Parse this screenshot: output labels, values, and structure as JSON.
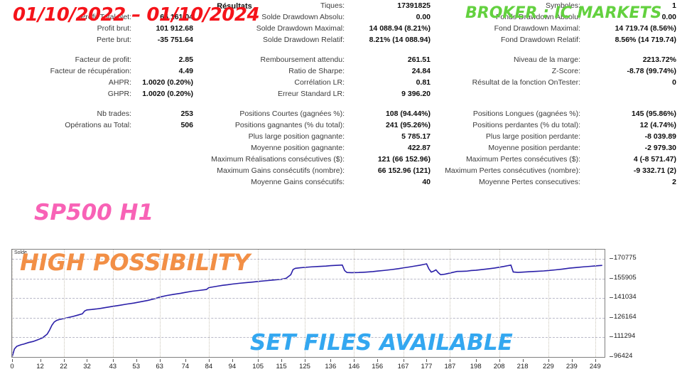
{
  "overlays": {
    "date_range": "01/10/2022  –  01/10/2024",
    "broker": "BROKER : IC MARKETS",
    "symbol_timeframe": "SP500 H1",
    "high_possibility": "HIGH POSSIBILITY",
    "set_files": "SET FILES AVAILABLE",
    "colors": {
      "date_range": "#f5131a",
      "broker": "#63d13f",
      "symbol_timeframe": "#f862b6",
      "high_possibility": "#f28f46",
      "set_files": "#33a7f0"
    }
  },
  "report": {
    "title": "Résultats",
    "groups": [
      {
        "rows": [
          {
            "c1_label": "",
            "c1_value": "",
            "c2_label": "Tiques:",
            "c2_value": "17391825",
            "c3_label": "Symboles:",
            "c3_value": "1"
          },
          {
            "c1_label": "Profit Total Net:",
            "c1_value": "66 161.04",
            "c2_label": "Solde Drawdown Absolu:",
            "c2_value": "0.00",
            "c3_label": "Fonds Drawdown Absolu:",
            "c3_value": "0.00"
          },
          {
            "c1_label": "Profit brut:",
            "c1_value": "101 912.68",
            "c2_label": "Solde Drawdown Maximal:",
            "c2_value": "14 088.94 (8.21%)",
            "c3_label": "Fond Drawdown Maximal:",
            "c3_value": "14 719.74 (8.56%)"
          },
          {
            "c1_label": "Perte brut:",
            "c1_value": "-35 751.64",
            "c2_label": "Solde Drawdown Relatif:",
            "c2_value": "8.21% (14 088.94)",
            "c3_label": "Fond Drawdown Relatif:",
            "c3_value": "8.56% (14 719.74)"
          }
        ]
      },
      {
        "rows": [
          {
            "c1_label": "Facteur de profit:",
            "c1_value": "2.85",
            "c2_label": "Remboursement attendu:",
            "c2_value": "261.51",
            "c3_label": "Niveau de la marge:",
            "c3_value": "2213.72%"
          },
          {
            "c1_label": "Facteur de récupération:",
            "c1_value": "4.49",
            "c2_label": "Ratio de Sharpe:",
            "c2_value": "24.84",
            "c3_label": "Z-Score:",
            "c3_value": "-8.78 (99.74%)"
          },
          {
            "c1_label": "AHPR:",
            "c1_value": "1.0020 (0.20%)",
            "c2_label": "Corrélation LR:",
            "c2_value": "0.81",
            "c3_label": "Résultat de la fonction OnTester:",
            "c3_value": "0"
          },
          {
            "c1_label": "GHPR:",
            "c1_value": "1.0020 (0.20%)",
            "c2_label": "Erreur Standard LR:",
            "c2_value": "9 396.20",
            "c3_label": "",
            "c3_value": ""
          }
        ]
      },
      {
        "rows": [
          {
            "c1_label": "Nb trades:",
            "c1_value": "253",
            "c2_label": "Positions Courtes (gagnées %):",
            "c2_value": "108 (94.44%)",
            "c3_label": "Positions Longues (gagnées %):",
            "c3_value": "145 (95.86%)"
          },
          {
            "c1_label": "Opérations au Total:",
            "c1_value": "506",
            "c2_label": "Positions gagnantes (% du total):",
            "c2_value": "241 (95.26%)",
            "c3_label": "Positions perdantes (% du total):",
            "c3_value": "12 (4.74%)"
          },
          {
            "c1_label": "",
            "c1_value": "",
            "c2_label": "Plus large position gagnante:",
            "c2_value": "5 785.17",
            "c3_label": "Plus large position perdante:",
            "c3_value": "-8 039.89"
          },
          {
            "c1_label": "",
            "c1_value": "",
            "c2_label": "Moyenne position gagnante:",
            "c2_value": "422.87",
            "c3_label": "Moyenne position perdante:",
            "c3_value": "-2 979.30"
          },
          {
            "c1_label": "",
            "c1_value": "",
            "c2_label": "Maximum Réalisations consécutives ($):",
            "c2_value": "121 (66 152.96)",
            "c3_label": "Maximum Pertes consécutives ($):",
            "c3_value": "4 (-8 571.47)"
          },
          {
            "c1_label": "",
            "c1_value": "",
            "c2_label": "Maximum Gains consécutifs (nombre):",
            "c2_value": "66 152.96 (121)",
            "c3_label": "Maximum Pertes consécutives (nombre):",
            "c3_value": "-9 332.71 (2)"
          },
          {
            "c1_label": "",
            "c1_value": "",
            "c2_label": "Moyenne Gains consécutifs:",
            "c2_value": "40",
            "c3_label": "Moyenne Pertes consecutives:",
            "c3_value": "2"
          }
        ]
      }
    ]
  },
  "chart_data": {
    "type": "line",
    "title": "",
    "series_label": "Solde",
    "xlabel": "",
    "ylabel": "",
    "line_color": "#2a1fa8",
    "grid": true,
    "legend_position": "top-left",
    "xlim": [
      0,
      253
    ],
    "ylim": [
      96424,
      178000
    ],
    "x_ticks": [
      0,
      12,
      22,
      32,
      43,
      53,
      63,
      74,
      84,
      94,
      105,
      115,
      125,
      136,
      146,
      156,
      167,
      177,
      187,
      198,
      208,
      218,
      229,
      239,
      249
    ],
    "y_ticks": [
      96424,
      111294,
      126164,
      141034,
      155905,
      170775
    ],
    "x": [
      0,
      1,
      2,
      3,
      4,
      5,
      7,
      9,
      11,
      13,
      15,
      16,
      17,
      18,
      19,
      20,
      22,
      24,
      26,
      28,
      30,
      31,
      32,
      34,
      36,
      38,
      40,
      43,
      46,
      49,
      52,
      55,
      58,
      61,
      63,
      66,
      69,
      72,
      74,
      77,
      80,
      83,
      84,
      86,
      88,
      90,
      92,
      94,
      97,
      100,
      103,
      105,
      108,
      111,
      113,
      115,
      117,
      119,
      120,
      121,
      123,
      125,
      128,
      131,
      134,
      136,
      139,
      141,
      142,
      143,
      145,
      148,
      151,
      154,
      156,
      159,
      162,
      165,
      167,
      170,
      172,
      174,
      176,
      177,
      178,
      179,
      180,
      181,
      182,
      183,
      184,
      185,
      186,
      187,
      188,
      190,
      192,
      194,
      196,
      198,
      200,
      203,
      206,
      208,
      210,
      212,
      213,
      214,
      216,
      218,
      221,
      224,
      227,
      229,
      232,
      235,
      238,
      241,
      244,
      247,
      249,
      252
    ],
    "y": [
      96424,
      102500,
      104500,
      105200,
      105800,
      106200,
      107400,
      108200,
      109500,
      111000,
      113800,
      116800,
      120500,
      123000,
      124200,
      124800,
      125600,
      126400,
      127200,
      128200,
      129200,
      131400,
      132200,
      132500,
      132900,
      133400,
      134000,
      134900,
      135700,
      136600,
      137400,
      138400,
      139400,
      140700,
      141900,
      143100,
      144000,
      144800,
      145500,
      146400,
      147000,
      147700,
      149100,
      149700,
      150300,
      150900,
      151300,
      151800,
      152400,
      152900,
      153400,
      153800,
      154300,
      154800,
      155100,
      155500,
      156200,
      158900,
      162900,
      163800,
      164200,
      164500,
      164900,
      165200,
      165500,
      165800,
      166100,
      166300,
      162100,
      160600,
      160500,
      160600,
      160900,
      161300,
      161700,
      162200,
      162800,
      163500,
      164100,
      164900,
      165500,
      166100,
      166800,
      167200,
      163300,
      160900,
      161600,
      162600,
      160500,
      158900,
      159100,
      159400,
      159800,
      160200,
      160600,
      161400,
      161500,
      161600,
      162100,
      162300,
      162700,
      163300,
      164000,
      164600,
      165200,
      165900,
      166200,
      161000,
      160700,
      160900,
      161200,
      161500,
      161800,
      162100,
      162600,
      163200,
      163900,
      164400,
      164900,
      165300,
      165600,
      166000
    ]
  }
}
